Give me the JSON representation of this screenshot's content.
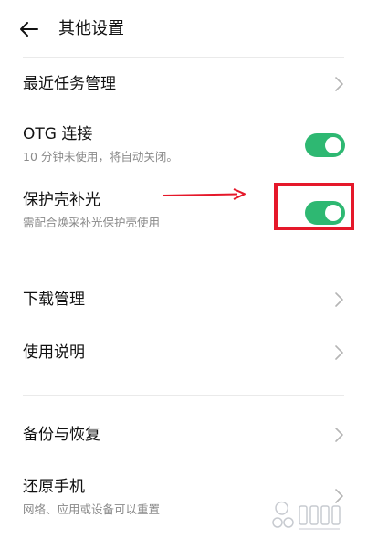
{
  "header": {
    "title": "其他设置"
  },
  "rows": [
    {
      "id": "recent-tasks",
      "label": "最近任务管理"
    },
    {
      "id": "otg",
      "label": "OTG 连接",
      "sub": "10 分钟未使用，将自动关闭。",
      "toggle": "on"
    },
    {
      "id": "case-light",
      "label": "保护壳补光",
      "sub": "需配合焕采补光保护壳使用",
      "toggle": "on"
    },
    {
      "id": "download",
      "label": "下载管理"
    },
    {
      "id": "usage",
      "label": "使用说明"
    },
    {
      "id": "backup",
      "label": "备份与恢复"
    },
    {
      "id": "restore",
      "label": "还原手机",
      "sub": "网络、应用或设备可以重置"
    }
  ],
  "colors": {
    "toggle_on": "#2eb872",
    "annotation": "#e5182a"
  }
}
